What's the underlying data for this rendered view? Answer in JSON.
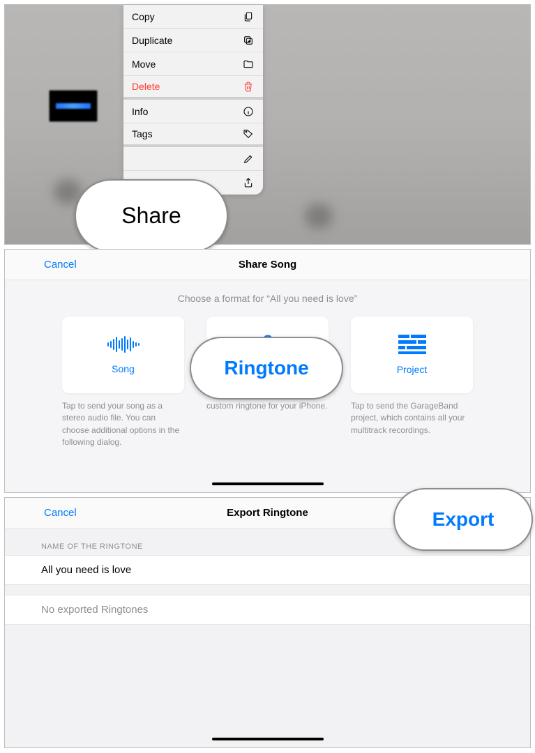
{
  "colors": {
    "accent": "#007aff",
    "destructive": "#ff3b30"
  },
  "panel1": {
    "menu": [
      {
        "label": "Copy",
        "icon": "copy-icon"
      },
      {
        "label": "Duplicate",
        "icon": "duplicate-icon"
      },
      {
        "label": "Move",
        "icon": "folder-icon"
      },
      {
        "label": "Delete",
        "icon": "trash-icon",
        "destructive": true
      },
      {
        "label": "Info",
        "icon": "info-icon"
      },
      {
        "label": "Tags",
        "icon": "tag-icon"
      },
      {
        "label": "",
        "icon": "pencil-icon"
      },
      {
        "label": "",
        "icon": "share-icon"
      }
    ],
    "highlight_label": "Share"
  },
  "panel2": {
    "cancel": "Cancel",
    "title": "Share Song",
    "subtitle": "Choose a format for “All you need is love”",
    "options": [
      {
        "label": "Song",
        "desc": "Tap to send your song as a stereo audio file. You can choose additional options in the following dialog."
      },
      {
        "label": "Ringtone",
        "desc": "custom ringtone for your iPhone."
      },
      {
        "label": "Project",
        "desc": "Tap to send the GarageBand project, which contains all your multitrack recordings."
      }
    ],
    "highlight_label": "Ringtone"
  },
  "panel3": {
    "cancel": "Cancel",
    "title": "Export Ringtone",
    "section_header": "Name of the Ringtone",
    "ringtone_name": "All you need is love",
    "empty_state": "No exported Ringtones",
    "highlight_label": "Export"
  }
}
